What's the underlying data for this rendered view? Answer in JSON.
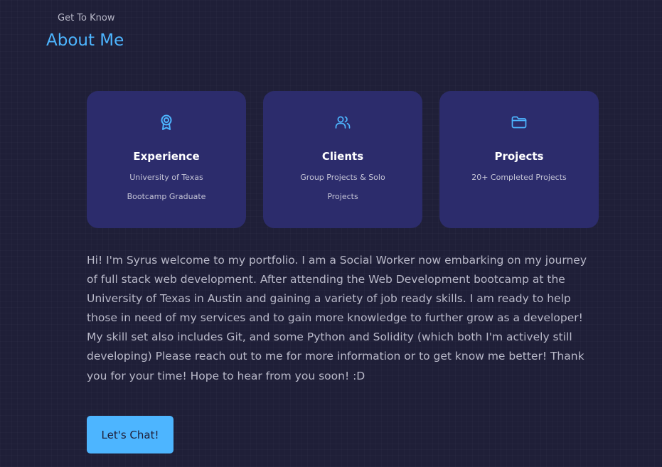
{
  "header": {
    "subtitle": "Get To Know",
    "title": "About Me"
  },
  "cards": [
    {
      "icon": "award-icon",
      "title": "Experience",
      "lines": [
        "University of Texas",
        "Bootcamp Graduate"
      ]
    },
    {
      "icon": "users-icon",
      "title": "Clients",
      "lines": [
        "Group Projects & Solo",
        "Projects"
      ]
    },
    {
      "icon": "folder-icon",
      "title": "Projects",
      "lines": [
        "20+ Completed Projects"
      ]
    }
  ],
  "bio": "Hi! I'm Syrus welcome to my portfolio. I am a Social Worker now embarking on my journey of full stack web development. After attending the Web Development bootcamp at the University of Texas in Austin and gaining a variety of job ready skills. I am ready to help those in need of my services and to gain more knowledge to further grow as a developer! My skill set also includes Git, and some Python and Solidity (which both I'm actively still developing) Please reach out to me for more information or to get know me better! Thank you for your time! Hope to hear from you soon! :D",
  "cta": {
    "label": "Let's Chat!"
  },
  "colors": {
    "background": "#1f1f38",
    "card": "#2c2c6c",
    "accent": "#4db5ff",
    "text_muted": "#b9b9c9"
  }
}
